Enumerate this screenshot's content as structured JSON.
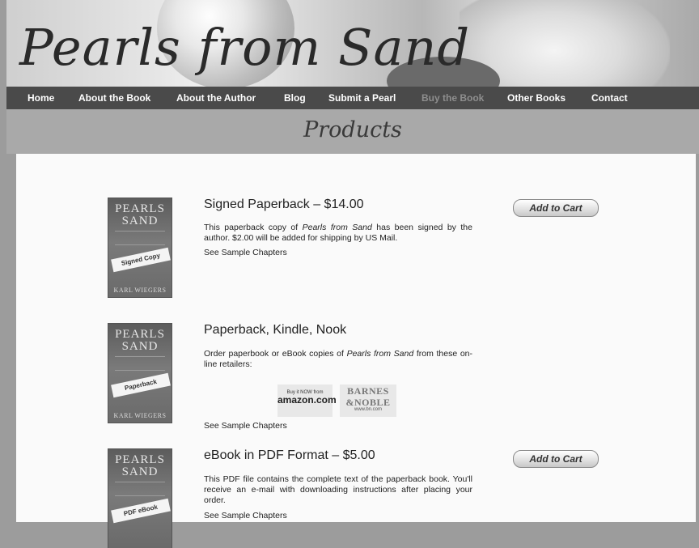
{
  "site": {
    "title": "Pearls from Sand"
  },
  "nav": {
    "items": [
      {
        "label": "Home",
        "active": false
      },
      {
        "label": "About the Book",
        "active": false
      },
      {
        "label": "About the Author",
        "active": false
      },
      {
        "label": "Blog",
        "active": false
      },
      {
        "label": "Submit a Pearl",
        "active": false
      },
      {
        "label": "Buy the Book",
        "active": true
      },
      {
        "label": "Other Books",
        "active": false
      },
      {
        "label": "Contact",
        "active": false
      }
    ]
  },
  "page": {
    "title": "Products"
  },
  "products": [
    {
      "title": "Signed Paperback – $14.00",
      "desc_before": "This paperback copy of ",
      "desc_em": "Pearls from Sand",
      "desc_after": " has been signed by the author. $2.00 will be added for shipping by US Mail.",
      "sample_link": "See Sample Chapters",
      "cart_label": "Add to Cart",
      "cover": {
        "title1": "PEARLS",
        "title2": "SAND",
        "badge": "Signed Copy",
        "author": "KARL WIEGERS"
      }
    },
    {
      "title": "Paperback, Kindle, Nook",
      "desc_before": "Order paperbook or eBook copies of ",
      "desc_em": "Pearls from Sand",
      "desc_after": " from these on-line retailers:",
      "sample_link": "See Sample Chapters",
      "cover": {
        "title1": "PEARLS",
        "title2": "SAND",
        "badge": "Paperback",
        "author": "KARL WIEGERS"
      },
      "retailers": {
        "amazon_small": "Buy it NOW from",
        "amazon_big": "amazon.com",
        "bn_line1": "BARNES",
        "bn_line2": "&NOBLE",
        "bn_small": "www.bn.com"
      }
    },
    {
      "title": "eBook in PDF Format – $5.00",
      "desc_before": "This PDF file contains the complete text of the paperback book. You'll receive an e-mail with downloading instructions after placing your order.",
      "desc_em": "",
      "desc_after": "",
      "sample_link": "See Sample Chapters",
      "cart_label": "Add to Cart",
      "cover": {
        "title1": "PEARLS",
        "title2": "SAND",
        "badge": "PDF eBook",
        "author": ""
      }
    }
  ]
}
